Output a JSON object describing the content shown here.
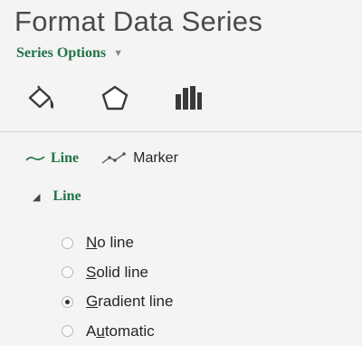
{
  "pane": {
    "title": "Format Data Series",
    "series_options_label": "Series Options",
    "series_options_caret": "▼"
  },
  "icons": [
    {
      "name": "fill-line-icon"
    },
    {
      "name": "effects-pentagon-icon"
    },
    {
      "name": "series-options-bars-icon"
    }
  ],
  "subtabs": [
    {
      "label": "Line",
      "icon": "line-icon",
      "active": true
    },
    {
      "label": "Marker",
      "icon": "marker-icon",
      "active": false
    }
  ],
  "section": {
    "label": "Line",
    "expanded": true,
    "toggle": "◢"
  },
  "line_options": [
    {
      "label": "No line",
      "access_key": "N",
      "selected": false
    },
    {
      "label": "Solid line",
      "access_key": "S",
      "selected": false
    },
    {
      "label": "Gradient line",
      "access_key": "G",
      "selected": true
    },
    {
      "label": "Automatic",
      "access_key": "u",
      "selected": false
    }
  ],
  "colors": {
    "accent": "#217346",
    "title": "#4a4a4a",
    "background": "#f4f4f4"
  }
}
